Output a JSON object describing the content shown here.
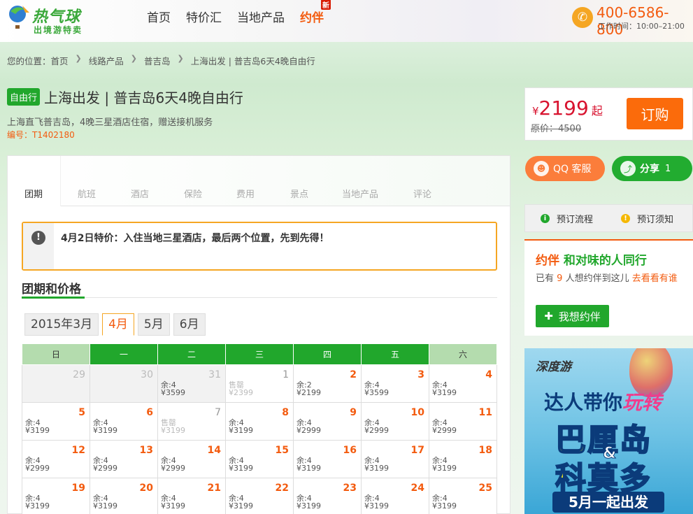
{
  "header": {
    "logo_main": "热气球",
    "logo_sub": "出境游特卖",
    "nav": [
      "首页",
      "特价汇",
      "当地产品",
      "约伴"
    ],
    "nav_new_badge": "新",
    "phone": "400-6586-800",
    "hours": "工作时间：10:00–21:00"
  },
  "breadcrumb": {
    "prefix": "您的位置：",
    "items": [
      "首页",
      "线路产品",
      "普吉岛",
      "上海出发 | 普吉岛6天4晚自由行"
    ]
  },
  "product": {
    "tag": "自由行",
    "title": "上海出发 | 普吉岛6天4晚自由行",
    "subtitle": "上海直飞普吉岛，4晚三星酒店住宿，赠送接机服务",
    "code": "编号：T1402180"
  },
  "price": {
    "currency": "¥",
    "value": "2199",
    "suffix": "起",
    "original": "原价：4500",
    "book_label": "订购"
  },
  "service": {
    "qq_label": "QQ 客服",
    "share_label": "分享",
    "share_count": "1"
  },
  "steps": {
    "flow": "预订流程",
    "notice": "预订须知"
  },
  "companion": {
    "brand": "约伴",
    "title_rest": "和对味的人同行",
    "text_pre": "已有",
    "count": "9",
    "text_mid": "人想约伴到这儿",
    "link": "去看看有谁",
    "button": "我想约伴"
  },
  "ad": {
    "brand": "深度游",
    "line1_a": "达人带你",
    "line1_b": "玩转",
    "line2": "巴厘岛",
    "amp": "&",
    "line3": "科莫多",
    "line4": "5月一起出发"
  },
  "tabs": [
    "团期",
    "航班",
    "酒店",
    "保险",
    "费用",
    "景点",
    "当地产品",
    "评论"
  ],
  "notice": "4月2日特价：入住当地三星酒店，最后两个位置，先到先得！",
  "section_title": "团期和价格",
  "months": [
    "2015年3月",
    "4月",
    "5月",
    "6月"
  ],
  "weekdays": [
    "日",
    "一",
    "二",
    "三",
    "四",
    "五",
    "六"
  ],
  "calendar": [
    [
      {
        "d": "29",
        "past": true,
        "st": "",
        "pr": ""
      },
      {
        "d": "30",
        "past": true,
        "st": "",
        "pr": ""
      },
      {
        "d": "31",
        "past": true,
        "st": "余:4",
        "pr": "¥3599"
      },
      {
        "d": "1",
        "sold": true,
        "st": "售罄",
        "pr": "¥2399"
      },
      {
        "d": "2",
        "st": "余:2",
        "pr": "¥2199"
      },
      {
        "d": "3",
        "st": "余:4",
        "pr": "¥3599"
      },
      {
        "d": "4",
        "st": "余:4",
        "pr": "¥3199"
      }
    ],
    [
      {
        "d": "5",
        "st": "余:4",
        "pr": "¥3199"
      },
      {
        "d": "6",
        "st": "余:4",
        "pr": "¥3199"
      },
      {
        "d": "7",
        "sold": true,
        "st": "售罄",
        "pr": "¥3199"
      },
      {
        "d": "8",
        "st": "余:4",
        "pr": "¥3199"
      },
      {
        "d": "9",
        "st": "余:4",
        "pr": "¥2999"
      },
      {
        "d": "10",
        "st": "余:4",
        "pr": "¥2999"
      },
      {
        "d": "11",
        "st": "余:4",
        "pr": "¥2999"
      }
    ],
    [
      {
        "d": "12",
        "st": "余:4",
        "pr": "¥2999"
      },
      {
        "d": "13",
        "st": "余:4",
        "pr": "¥2999"
      },
      {
        "d": "14",
        "st": "余:4",
        "pr": "¥2999"
      },
      {
        "d": "15",
        "st": "余:4",
        "pr": "¥3199"
      },
      {
        "d": "16",
        "st": "余:4",
        "pr": "¥3199"
      },
      {
        "d": "17",
        "st": "余:4",
        "pr": "¥3199"
      },
      {
        "d": "18",
        "st": "余:4",
        "pr": "¥3199"
      }
    ],
    [
      {
        "d": "19",
        "st": "余:4",
        "pr": "¥3199"
      },
      {
        "d": "20",
        "st": "余:4",
        "pr": "¥3199"
      },
      {
        "d": "21",
        "st": "余:4",
        "pr": "¥3199"
      },
      {
        "d": "22",
        "st": "余:4",
        "pr": "¥3199"
      },
      {
        "d": "23",
        "st": "余:4",
        "pr": "¥3199"
      },
      {
        "d": "24",
        "st": "余:4",
        "pr": "¥3199"
      },
      {
        "d": "25",
        "st": "余:4",
        "pr": "¥3199"
      }
    ]
  ],
  "colors": {
    "brand_green": "#21a72c",
    "accent_orange": "#f35b0f",
    "price_red": "#d8132f"
  }
}
